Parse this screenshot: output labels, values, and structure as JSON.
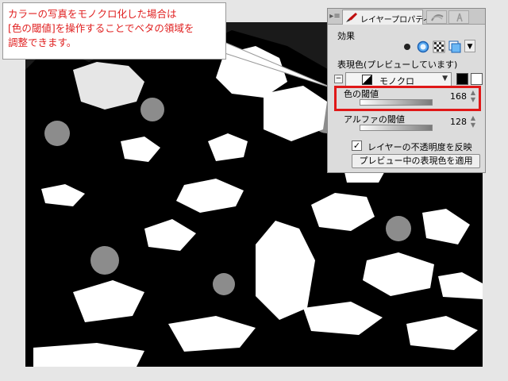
{
  "callout": {
    "line1": "カラーの写真をモノクロ化した場合は",
    "line2": "[色の閾値]を操作することでベタの領域を",
    "line3": "調整できます。",
    "color": "#e02020"
  },
  "panel": {
    "tab_label": "レイヤープロパティ",
    "tab_menu_icon": "panel-menu-icon",
    "effect_title": "効果",
    "expression_title": "表現色(プレビューしています)",
    "mode_value": "モノクロ",
    "color_threshold_label": "色の閾値",
    "color_threshold_value": "168",
    "color_threshold_fraction": 0.66,
    "alpha_threshold_label": "アルファの閾値",
    "alpha_threshold_value": "128",
    "alpha_threshold_fraction": 0.5,
    "reflect_opacity_label": "レイヤーの不透明度を反映",
    "reflect_opacity_checked": true,
    "apply_button_label": "プレビュー中の表現色を適用"
  },
  "colors": {
    "highlight": "#e01818",
    "panel_bg": "#dcdcdc",
    "accent_blue": "#2a7fd4"
  }
}
